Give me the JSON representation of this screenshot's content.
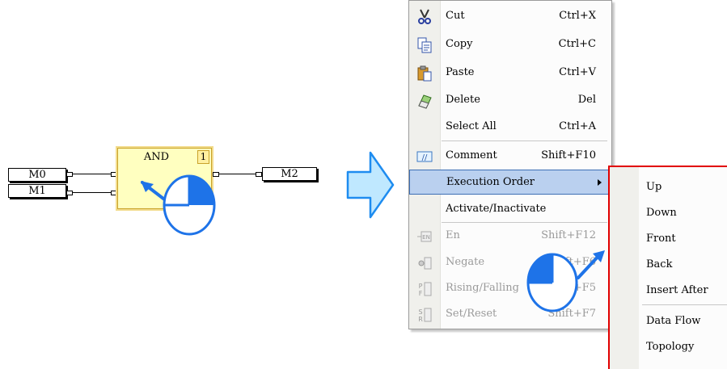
{
  "diagram": {
    "inputs": [
      "M0",
      "M1"
    ],
    "output": "M2",
    "block": {
      "title": "AND",
      "order": "1"
    }
  },
  "menu": {
    "items": [
      {
        "label": "Cut",
        "shortcut": "Ctrl+X",
        "icon": "scissors-icon",
        "enabled": true
      },
      {
        "label": "Copy",
        "shortcut": "Ctrl+C",
        "icon": "copy-icon",
        "enabled": true
      },
      {
        "label": "Paste",
        "shortcut": "Ctrl+V",
        "icon": "paste-icon",
        "enabled": true
      },
      {
        "label": "Delete",
        "shortcut": "Del",
        "icon": "eraser-icon",
        "enabled": true
      },
      {
        "label": "Select All",
        "shortcut": "Ctrl+A",
        "icon": "",
        "enabled": true
      },
      {
        "label": "Comment",
        "shortcut": "Shift+F10",
        "icon": "comment-icon",
        "enabled": true
      },
      {
        "label": "Execution Order",
        "shortcut": "",
        "icon": "",
        "enabled": true,
        "highlighted": true,
        "submenu": true
      },
      {
        "label": "Activate/Inactivate",
        "shortcut": "",
        "icon": "",
        "enabled": true
      },
      {
        "label": "En",
        "shortcut": "Shift+F12",
        "icon": "en-icon",
        "enabled": false
      },
      {
        "label": "Negate",
        "shortcut": "Shift+F6",
        "icon": "negate-icon",
        "enabled": false
      },
      {
        "label": "Rising/Falling",
        "shortcut": "Shift+F5",
        "icon": "pf-icon",
        "enabled": false
      },
      {
        "label": "Set/Reset",
        "shortcut": "Shift+F7",
        "icon": "sr-icon",
        "enabled": false
      }
    ]
  },
  "submenu": {
    "items": [
      "Up",
      "Down",
      "Front",
      "Back",
      "Insert After",
      "Data Flow",
      "Topology"
    ]
  },
  "colors": {
    "highlight": "#bad0ef",
    "highlight_border": "#3d6fb4",
    "submenu_outline": "#e10000",
    "block_fill": "#ffffc0",
    "arrow_fill": "#bfe8ff",
    "arrow_stroke": "#1e8cf0",
    "mouse_stroke": "#1e73e8"
  }
}
